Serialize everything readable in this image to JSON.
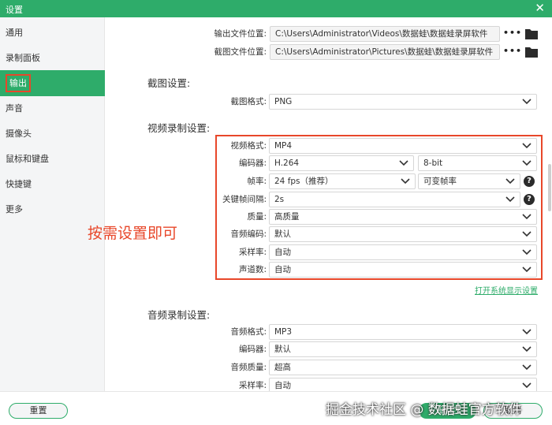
{
  "window": {
    "title": "设置",
    "close": "✕"
  },
  "sidebar": {
    "items": [
      {
        "label": "通用"
      },
      {
        "label": "录制面板"
      },
      {
        "label": "输出"
      },
      {
        "label": "声音"
      },
      {
        "label": "摄像头"
      },
      {
        "label": "鼠标和键盘"
      },
      {
        "label": "快捷键"
      },
      {
        "label": "更多"
      }
    ],
    "active_index": 2
  },
  "output": {
    "video_location": {
      "label": "输出文件位置:",
      "value": "C:\\Users\\Administrator\\Videos\\数据蛙\\数据蛙录屏软件"
    },
    "screenshot_location": {
      "label": "截图文件位置:",
      "value": "C:\\Users\\Administrator\\Pictures\\数据蛙\\数据蛙录屏软件"
    },
    "browse_dots": "•••"
  },
  "screenshot_settings": {
    "title": "截图设置:",
    "format": {
      "label": "截图格式:",
      "value": "PNG"
    }
  },
  "video_settings": {
    "title": "视频录制设置:",
    "format": {
      "label": "视频格式:",
      "value": "MP4"
    },
    "encoder": {
      "label": "编码器:",
      "value": "H.264",
      "bit_depth": "8-bit"
    },
    "frame_rate": {
      "label": "帧率:",
      "value": "24 fps（推荐）",
      "mode": "可变帧率"
    },
    "keyframe_interval": {
      "label": "关键帧间隔:",
      "value": "2s"
    },
    "quality": {
      "label": "质量:",
      "value": "高质量"
    },
    "audio_encoder": {
      "label": "音频编码:",
      "value": "默认"
    },
    "sample_rate": {
      "label": "采样率:",
      "value": "自动"
    },
    "channels": {
      "label": "声道数:",
      "value": "自动"
    },
    "open_display_link": "打开系统显示设置"
  },
  "annotation": {
    "note": "按需设置即可"
  },
  "audio_settings": {
    "title": "音频录制设置:",
    "format": {
      "label": "音频格式:",
      "value": "MP3"
    },
    "encoder": {
      "label": "编码器:",
      "value": "默认"
    },
    "quality": {
      "label": "音频质量:",
      "value": "超高"
    },
    "sample_rate": {
      "label": "采样率:",
      "value": "自动"
    }
  },
  "footer": {
    "reset": "重置",
    "ok": "确定",
    "cancel": "取消",
    "watermark": "掘金技术社区 @ 数据蛙官方软件"
  },
  "colors": {
    "accent": "#2eac6a",
    "highlight": "#e8472a"
  },
  "help_icon": "?"
}
